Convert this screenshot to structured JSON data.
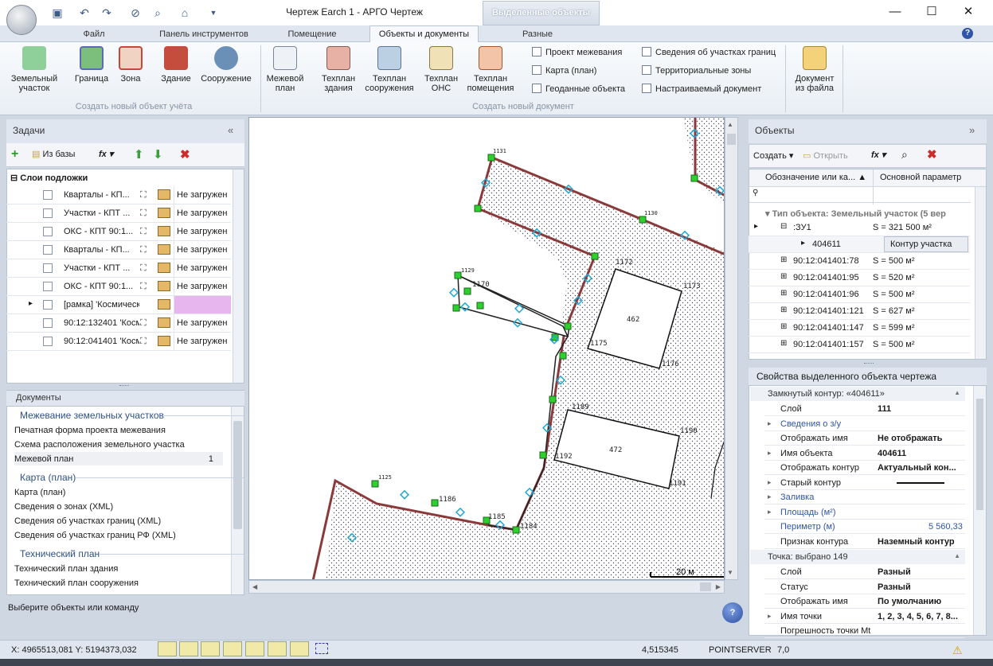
{
  "window": {
    "title": "Чертеж Earch 1 - АРГО Чертеж",
    "context_tab": "Выделенные объекты"
  },
  "tabs": [
    {
      "label": "Файл"
    },
    {
      "label": "Панель инструментов"
    },
    {
      "label": "Помещение"
    },
    {
      "label": "Объекты и документы"
    },
    {
      "label": "Разные"
    }
  ],
  "ribbon": {
    "group1": {
      "label": "Создать новый объект учёта",
      "buttons": [
        "Земельный участок",
        "Граница",
        "Зона",
        "Здание",
        "Сооружение"
      ]
    },
    "group2": {
      "label": "Создать новый документ",
      "buttons": [
        "Межевой план",
        "Техплан здания",
        "Техплан сооружения",
        "Техплан ОНС",
        "Техплан помещения"
      ],
      "small_col1": [
        "Проект межевания",
        "Карта (план)",
        "Геоданные объекта"
      ],
      "small_col2": [
        "Сведения об участках границ",
        "Территориальные зоны",
        "Настраиваемый документ"
      ]
    },
    "group3": {
      "buttons": [
        "Документ из файла"
      ]
    }
  },
  "tasks": {
    "title": "Задачи",
    "toolbar": {
      "from_base": "Из базы",
      "fx": "fx"
    },
    "layers_root": "Слои подложки",
    "layers": [
      {
        "name": "Кварталы - КП...",
        "status": "Не загружен"
      },
      {
        "name": "Участки - КПТ ...",
        "status": "Не загружен"
      },
      {
        "name": "ОКС - КПТ 90:1...",
        "status": "Не загружен"
      },
      {
        "name": "Кварталы - КП...",
        "status": "Не загружен"
      },
      {
        "name": "Участки - КПТ ...",
        "status": "Не загружен"
      },
      {
        "name": "ОКС - КПТ 90:1...",
        "status": "Не загружен"
      },
      {
        "name": "[рамка] 'Космическ...",
        "status": ""
      },
      {
        "name": "90:12:132401 'Косм...",
        "status": "Не загружен"
      },
      {
        "name": "90:12:041401 'Косм...",
        "status": "Не загружен"
      }
    ]
  },
  "documents": {
    "title": "Документы",
    "sections": [
      {
        "title": "Межевание земельных участков",
        "items": [
          "Печатная форма проекта межевания",
          "Схема расположения земельного участка",
          "Межевой план"
        ],
        "count": "1"
      },
      {
        "title": "Карта (план)",
        "items": [
          "Карта (план)",
          "Сведения о зонах (XML)",
          "Сведения об участках границ (XML)",
          "Сведения об участках границ РФ (XML)"
        ]
      },
      {
        "title": "Технический план",
        "items": [
          "Технический план здания",
          "Технический план сооружения"
        ]
      }
    ]
  },
  "command_prompt": "Выберите объекты или команду",
  "canvas": {
    "labels": [
      "1131",
      "1172",
      "1173",
      "462",
      "1175",
      "1176",
      "1170",
      "1129",
      "1189",
      "1192",
      "472",
      "1190",
      "1191",
      "1186",
      "1185",
      "1125",
      "1184",
      "1130"
    ],
    "scale": "20 м"
  },
  "objects": {
    "title": "Объекты",
    "toolbar": {
      "create": "Создать",
      "open": "Открыть",
      "fx": "fx"
    },
    "columns": [
      "Обозначение или ка...",
      "Основной параметр"
    ],
    "group": "Тип объекта: Земельный участок (5 вер",
    "rows": [
      {
        "name": ":ЗУ1",
        "param": "S = 321 500 м²"
      },
      {
        "name": "404611",
        "param": "Контур участка"
      },
      {
        "name": "90:12:041401:78",
        "param": "S = 500 м²"
      },
      {
        "name": "90:12:041401:95",
        "param": "S = 520 м²"
      },
      {
        "name": "90:12:041401:96",
        "param": "S = 500 м²"
      },
      {
        "name": "90:12:041401:121",
        "param": "S = 627 м²"
      },
      {
        "name": "90:12:041401:147",
        "param": "S = 599 м²"
      },
      {
        "name": "90:12:041401:157",
        "param": "S = 500 м²"
      }
    ]
  },
  "properties": {
    "title": "Свойства выделенного объекта чертежа",
    "header1": "Замкнутый контур: «404611»",
    "rows1": [
      {
        "k": "Слой",
        "v": "111"
      },
      {
        "k": "Сведения о з/у",
        "v": ""
      },
      {
        "k": "Отображать имя",
        "v": "Не отображать"
      },
      {
        "k": "Имя объекта",
        "v": "404611"
      },
      {
        "k": "Отображать контур",
        "v": "Актуальный кон..."
      },
      {
        "k": "Старый контур",
        "v": ""
      },
      {
        "k": "Заливка",
        "v": ""
      },
      {
        "k": "Площадь (м²)",
        "v": ""
      },
      {
        "k": "Периметр (м)",
        "v": "5 560,33"
      },
      {
        "k": "Признак контура",
        "v": "Наземный контур"
      }
    ],
    "header2": "Точка: выбрано 149",
    "rows2": [
      {
        "k": "Слой",
        "v": "Разный"
      },
      {
        "k": "Статус",
        "v": "Разный"
      },
      {
        "k": "Отображать имя",
        "v": "По умолчанию"
      },
      {
        "k": "Имя точки",
        "v": "1, 2, 3, 4, 5, 6, 7, 8..."
      },
      {
        "k": "Погрешность точки Mt",
        "v": ""
      }
    ]
  },
  "statusbar": {
    "coords": "X: 4965513,081 Y: 5194373,032",
    "value": "4,515345",
    "server": "POINTSERVER",
    "extra": "7,0"
  }
}
